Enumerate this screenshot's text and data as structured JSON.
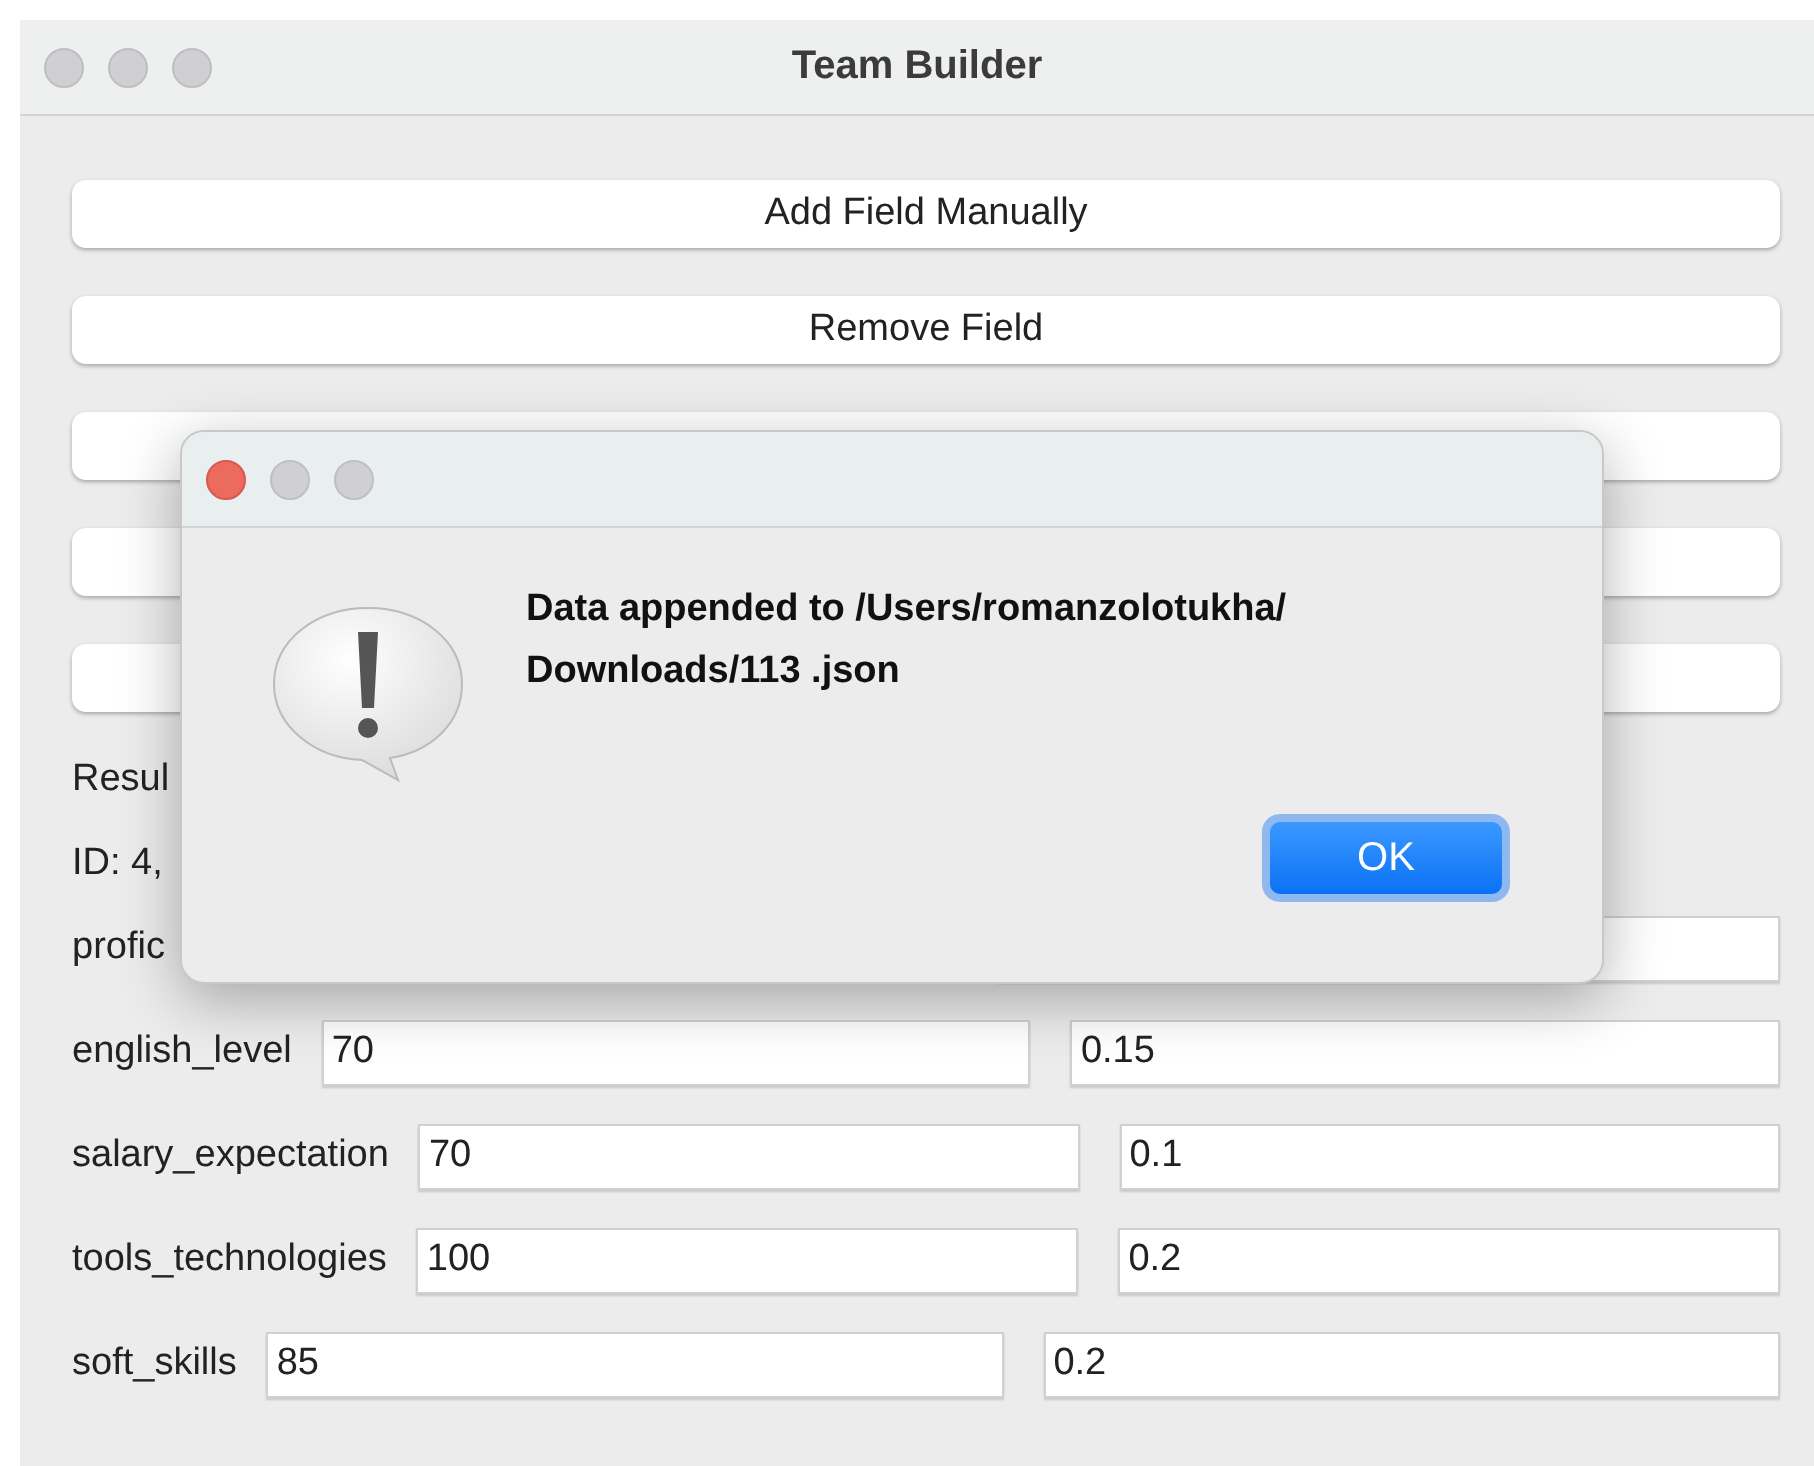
{
  "window": {
    "title": "Team Builder",
    "active": false
  },
  "buttons": [
    {
      "kind": "text",
      "label": "Add Field Manually"
    },
    {
      "kind": "text",
      "label": "Remove Field"
    },
    {
      "kind": "blank"
    },
    {
      "kind": "blank"
    },
    {
      "kind": "blank"
    }
  ],
  "result_label": "Resul",
  "id_label": "ID: 4,",
  "fields": [
    {
      "label": "profic"
    },
    {
      "label": "english_level",
      "value": "70",
      "weight": "0.15"
    },
    {
      "label": "salary_expectation",
      "value": "70",
      "weight": "0.1"
    },
    {
      "label": "tools_technologies",
      "value": "100",
      "weight": "0.2"
    },
    {
      "label": "soft_skills",
      "value": "85",
      "weight": "0.2"
    }
  ],
  "dialog": {
    "active": true,
    "message_lines": [
      "Data appended to /Users/romanzolotukha/",
      "Downloads/113 .json"
    ],
    "button": "OK"
  }
}
